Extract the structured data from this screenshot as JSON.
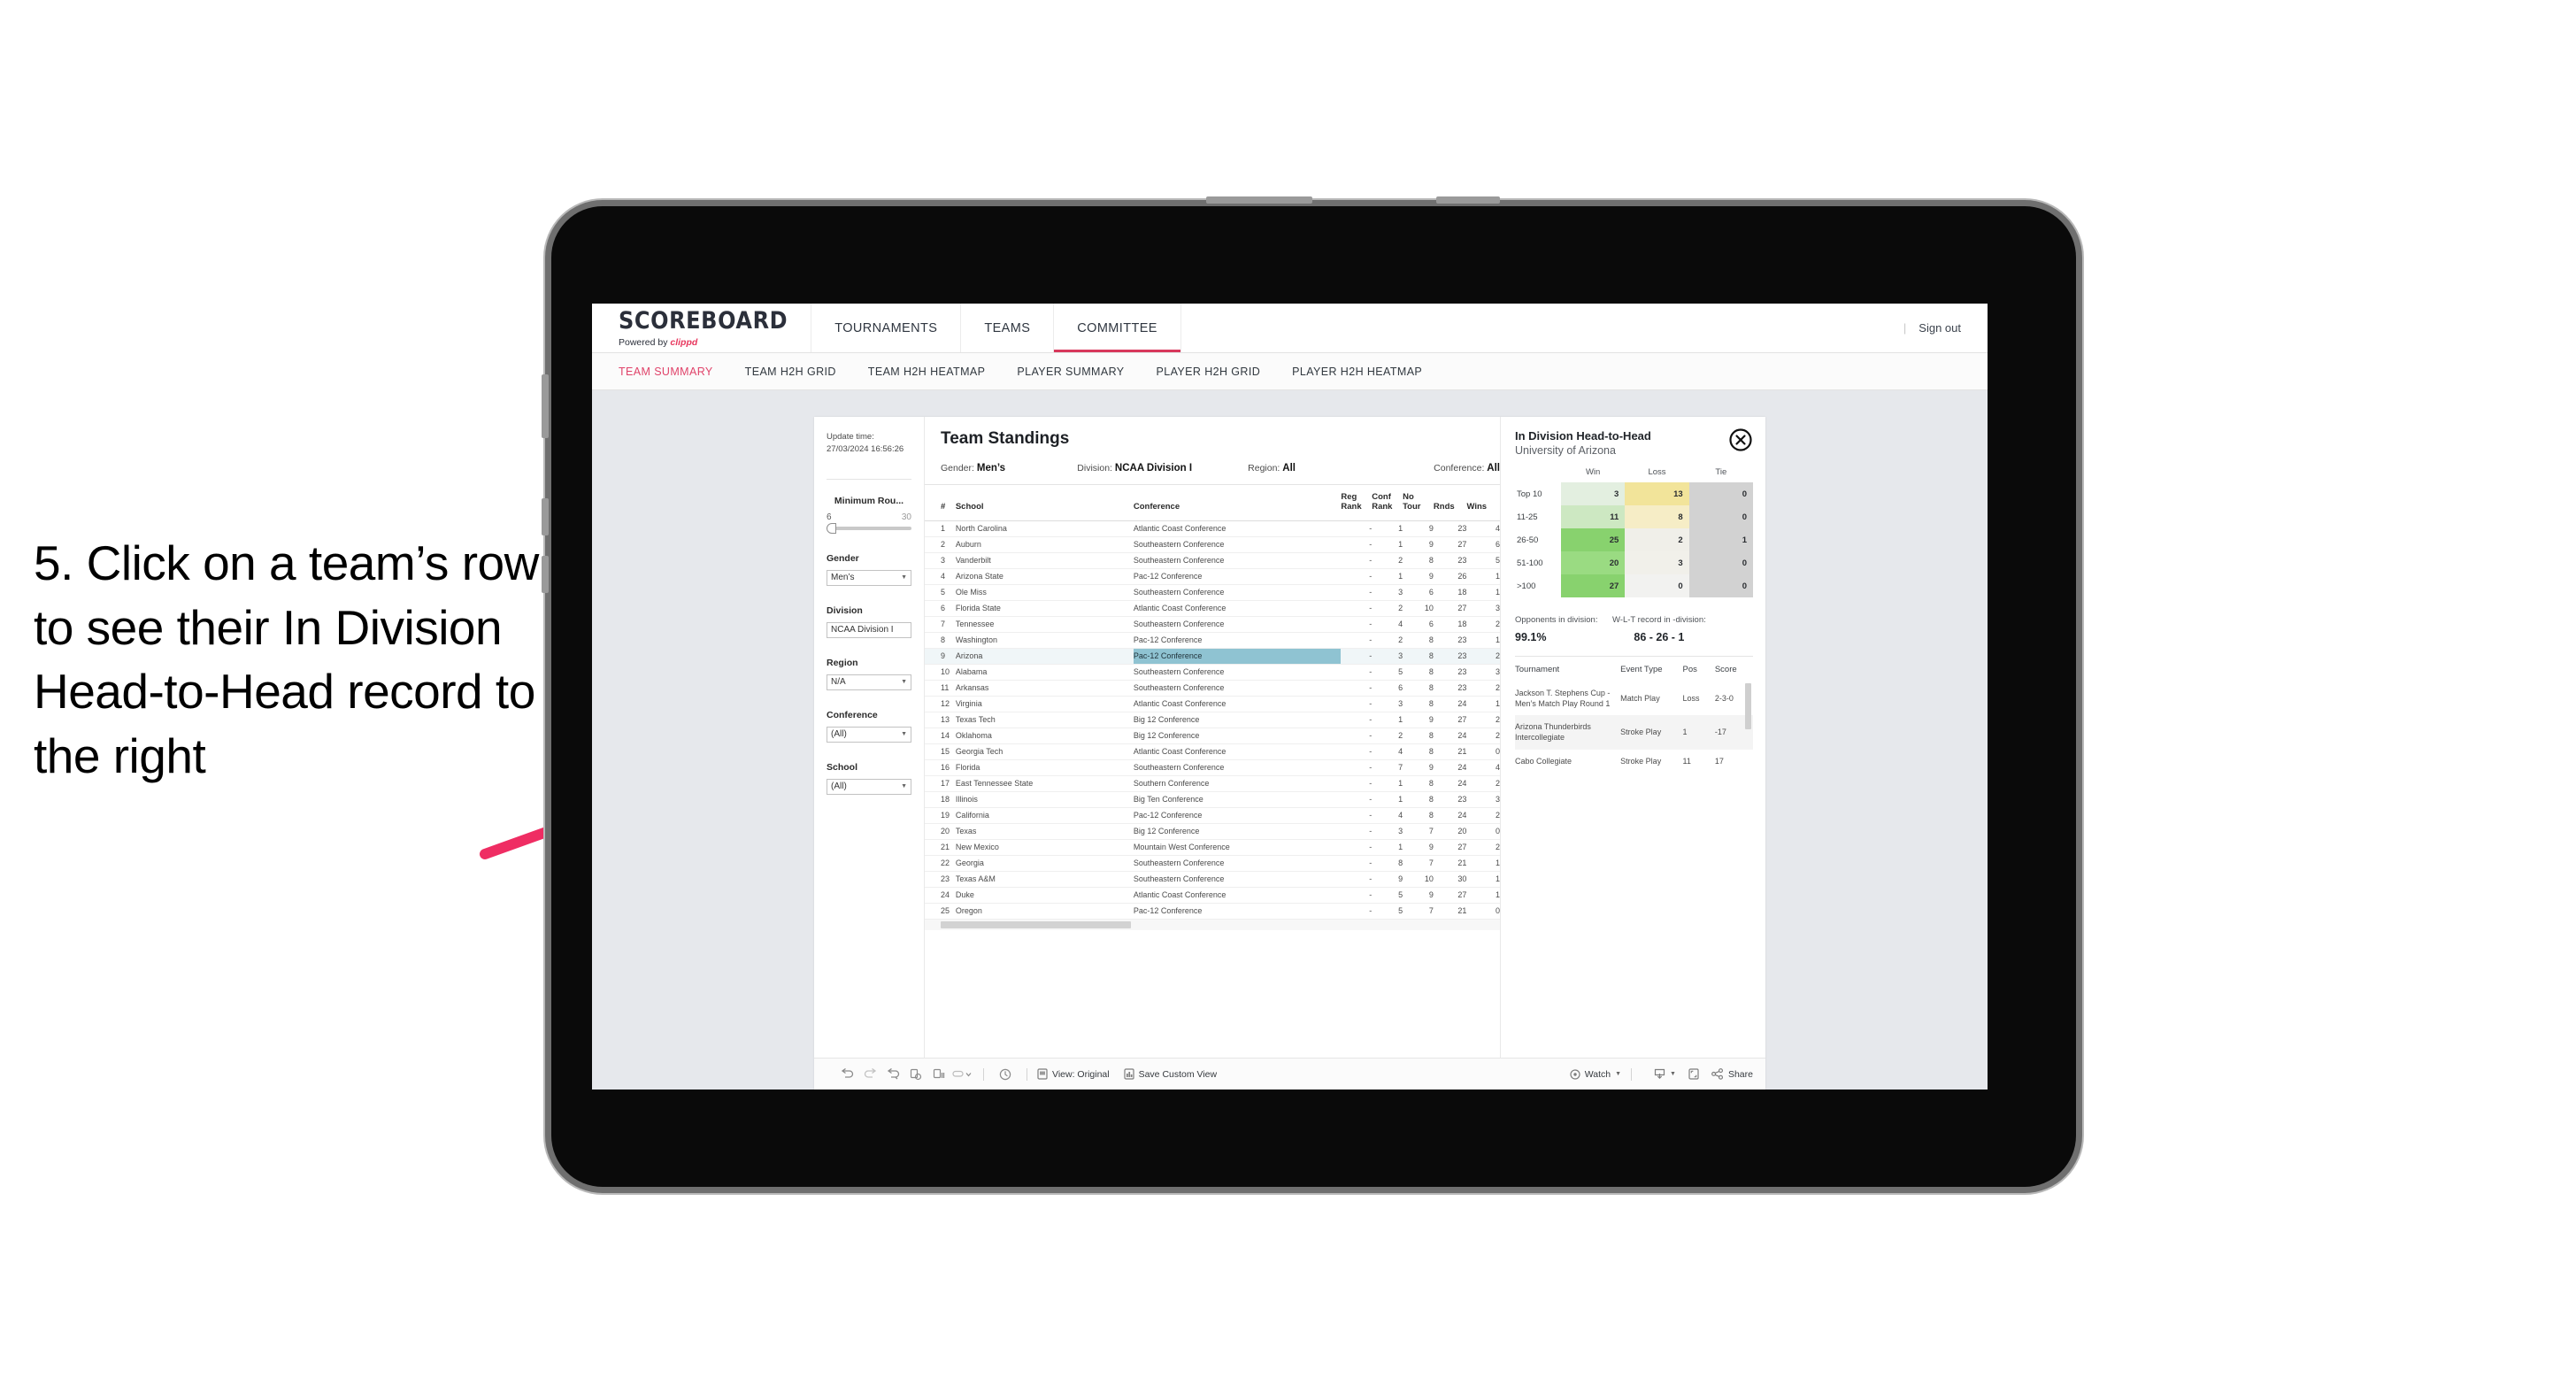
{
  "instruction": {
    "text": "5. Click on a team’s row to see their In Division Head-to-Head record to the right"
  },
  "colors": {
    "accent_pink": "#d8385c",
    "brand_pink": "#e8395f",
    "selected_cell": "#8fc3d2",
    "screen_bg": "#e6e8ec"
  },
  "topnav": {
    "brand_title": "SCOREBOARD",
    "brand_powered": "Powered by ",
    "brand_name": "clippd",
    "items": [
      {
        "label": "TOURNAMENTS",
        "active": false
      },
      {
        "label": "TEAMS",
        "active": false
      },
      {
        "label": "COMMITTEE",
        "active": true
      }
    ],
    "divider": "|",
    "signout": "Sign out"
  },
  "subnav": {
    "items": [
      {
        "label": "TEAM SUMMARY",
        "active": true
      },
      {
        "label": "TEAM H2H GRID",
        "active": false
      },
      {
        "label": "TEAM H2H HEATMAP",
        "active": false
      },
      {
        "label": "PLAYER SUMMARY",
        "active": false
      },
      {
        "label": "PLAYER H2H GRID",
        "active": false
      },
      {
        "label": "PLAYER H2H HEATMAP",
        "active": false
      }
    ]
  },
  "filters": {
    "update_time_label": "Update time:",
    "update_time_value": "27/03/2024 16:56:26",
    "min_rounds": {
      "label": "Minimum Rou...",
      "low": "6",
      "high": "30"
    },
    "gender": {
      "label": "Gender",
      "value": "Men’s"
    },
    "division": {
      "label": "Division",
      "value": "NCAA Division I"
    },
    "region": {
      "label": "Region",
      "value": "N/A"
    },
    "conference": {
      "label": "Conference",
      "value": "(All)"
    },
    "school": {
      "label": "School",
      "value": "(All)"
    }
  },
  "standings": {
    "title": "Team Standings",
    "applied": {
      "gender_label": "Gender:",
      "gender_value": "Men’s",
      "division_label": "Division:",
      "division_value": "NCAA Division I",
      "region_label": "Region:",
      "region_value": "All",
      "conference_label": "Conference:",
      "conference_value": "All"
    },
    "columns": [
      "#",
      "School",
      "Conference",
      "Reg Rank",
      "Conf Rank",
      "No Tour",
      "Rnds",
      "Wins"
    ],
    "rows": [
      {
        "rank": "1",
        "school": "North Carolina",
        "conference": "Atlantic Coast Conference",
        "reg_rank": "-",
        "conf_rank": "1",
        "no_tour": "9",
        "rnds": "23",
        "wins": "4",
        "selected": false
      },
      {
        "rank": "2",
        "school": "Auburn",
        "conference": "Southeastern Conference",
        "reg_rank": "-",
        "conf_rank": "1",
        "no_tour": "9",
        "rnds": "27",
        "wins": "6",
        "selected": false
      },
      {
        "rank": "3",
        "school": "Vanderbilt",
        "conference": "Southeastern Conference",
        "reg_rank": "-",
        "conf_rank": "2",
        "no_tour": "8",
        "rnds": "23",
        "wins": "5",
        "selected": false
      },
      {
        "rank": "4",
        "school": "Arizona State",
        "conference": "Pac-12 Conference",
        "reg_rank": "-",
        "conf_rank": "1",
        "no_tour": "9",
        "rnds": "26",
        "wins": "1",
        "selected": false
      },
      {
        "rank": "5",
        "school": "Ole Miss",
        "conference": "Southeastern Conference",
        "reg_rank": "-",
        "conf_rank": "3",
        "no_tour": "6",
        "rnds": "18",
        "wins": "1",
        "selected": false
      },
      {
        "rank": "6",
        "school": "Florida State",
        "conference": "Atlantic Coast Conference",
        "reg_rank": "-",
        "conf_rank": "2",
        "no_tour": "10",
        "rnds": "27",
        "wins": "3",
        "selected": false
      },
      {
        "rank": "7",
        "school": "Tennessee",
        "conference": "Southeastern Conference",
        "reg_rank": "-",
        "conf_rank": "4",
        "no_tour": "6",
        "rnds": "18",
        "wins": "2",
        "selected": false
      },
      {
        "rank": "8",
        "school": "Washington",
        "conference": "Pac-12 Conference",
        "reg_rank": "-",
        "conf_rank": "2",
        "no_tour": "8",
        "rnds": "23",
        "wins": "1",
        "selected": false
      },
      {
        "rank": "9",
        "school": "Arizona",
        "conference": "Pac-12 Conference",
        "reg_rank": "-",
        "conf_rank": "3",
        "no_tour": "8",
        "rnds": "23",
        "wins": "2",
        "selected": true
      },
      {
        "rank": "10",
        "school": "Alabama",
        "conference": "Southeastern Conference",
        "reg_rank": "-",
        "conf_rank": "5",
        "no_tour": "8",
        "rnds": "23",
        "wins": "3",
        "selected": false
      },
      {
        "rank": "11",
        "school": "Arkansas",
        "conference": "Southeastern Conference",
        "reg_rank": "-",
        "conf_rank": "6",
        "no_tour": "8",
        "rnds": "23",
        "wins": "2",
        "selected": false
      },
      {
        "rank": "12",
        "school": "Virginia",
        "conference": "Atlantic Coast Conference",
        "reg_rank": "-",
        "conf_rank": "3",
        "no_tour": "8",
        "rnds": "24",
        "wins": "1",
        "selected": false
      },
      {
        "rank": "13",
        "school": "Texas Tech",
        "conference": "Big 12 Conference",
        "reg_rank": "-",
        "conf_rank": "1",
        "no_tour": "9",
        "rnds": "27",
        "wins": "2",
        "selected": false
      },
      {
        "rank": "14",
        "school": "Oklahoma",
        "conference": "Big 12 Conference",
        "reg_rank": "-",
        "conf_rank": "2",
        "no_tour": "8",
        "rnds": "24",
        "wins": "2",
        "selected": false
      },
      {
        "rank": "15",
        "school": "Georgia Tech",
        "conference": "Atlantic Coast Conference",
        "reg_rank": "-",
        "conf_rank": "4",
        "no_tour": "8",
        "rnds": "21",
        "wins": "0",
        "selected": false
      },
      {
        "rank": "16",
        "school": "Florida",
        "conference": "Southeastern Conference",
        "reg_rank": "-",
        "conf_rank": "7",
        "no_tour": "9",
        "rnds": "24",
        "wins": "4",
        "selected": false
      },
      {
        "rank": "17",
        "school": "East Tennessee State",
        "conference": "Southern Conference",
        "reg_rank": "-",
        "conf_rank": "1",
        "no_tour": "8",
        "rnds": "24",
        "wins": "2",
        "selected": false
      },
      {
        "rank": "18",
        "school": "Illinois",
        "conference": "Big Ten Conference",
        "reg_rank": "-",
        "conf_rank": "1",
        "no_tour": "8",
        "rnds": "23",
        "wins": "3",
        "selected": false
      },
      {
        "rank": "19",
        "school": "California",
        "conference": "Pac-12 Conference",
        "reg_rank": "-",
        "conf_rank": "4",
        "no_tour": "8",
        "rnds": "24",
        "wins": "2",
        "selected": false
      },
      {
        "rank": "20",
        "school": "Texas",
        "conference": "Big 12 Conference",
        "reg_rank": "-",
        "conf_rank": "3",
        "no_tour": "7",
        "rnds": "20",
        "wins": "0",
        "selected": false
      },
      {
        "rank": "21",
        "school": "New Mexico",
        "conference": "Mountain West Conference",
        "reg_rank": "-",
        "conf_rank": "1",
        "no_tour": "9",
        "rnds": "27",
        "wins": "2",
        "selected": false
      },
      {
        "rank": "22",
        "school": "Georgia",
        "conference": "Southeastern Conference",
        "reg_rank": "-",
        "conf_rank": "8",
        "no_tour": "7",
        "rnds": "21",
        "wins": "1",
        "selected": false
      },
      {
        "rank": "23",
        "school": "Texas A&M",
        "conference": "Southeastern Conference",
        "reg_rank": "-",
        "conf_rank": "9",
        "no_tour": "10",
        "rnds": "30",
        "wins": "1",
        "selected": false
      },
      {
        "rank": "24",
        "school": "Duke",
        "conference": "Atlantic Coast Conference",
        "reg_rank": "-",
        "conf_rank": "5",
        "no_tour": "9",
        "rnds": "27",
        "wins": "1",
        "selected": false
      },
      {
        "rank": "25",
        "school": "Oregon",
        "conference": "Pac-12 Conference",
        "reg_rank": "-",
        "conf_rank": "5",
        "no_tour": "7",
        "rnds": "21",
        "wins": "0",
        "selected": false
      }
    ]
  },
  "h2h": {
    "title": "In Division Head-to-Head",
    "subtitle": "University of Arizona",
    "close_icon": "close-circle-icon",
    "columns": [
      "",
      "Win",
      "Loss",
      "Tie"
    ],
    "rows": [
      {
        "bucket": "Top 10",
        "win": "3",
        "loss": "13",
        "tie": "0",
        "win_color": "#e3efe0",
        "loss_color": "#f2e49a",
        "tie_color": "#d2d2d2"
      },
      {
        "bucket": "11-25",
        "win": "11",
        "loss": "8",
        "tie": "0",
        "win_color": "#cde8c2",
        "loss_color": "#f6edc6",
        "tie_color": "#d2d2d2"
      },
      {
        "bucket": "26-50",
        "win": "25",
        "loss": "2",
        "tie": "1",
        "win_color": "#88d26e",
        "loss_color": "#f0efe9",
        "tie_color": "#d2d2d2"
      },
      {
        "bucket": "51-100",
        "win": "20",
        "loss": "3",
        "tie": "0",
        "win_color": "#9adb82",
        "loss_color": "#f1f0ea",
        "tie_color": "#d2d2d2"
      },
      {
        "bucket": ">100",
        "win": "27",
        "loss": "0",
        "tie": "0",
        "win_color": "#88d26e",
        "loss_color": "#f2f2f0",
        "tie_color": "#d2d2d2"
      }
    ],
    "summary": {
      "opponents_label": "Opponents in division:",
      "opponents_value": "99.1%",
      "record_label": "W-L-T record in -division:",
      "record_value": "86 - 26 - 1"
    },
    "tournaments": {
      "columns": [
        "Tournament",
        "Event Type",
        "Pos",
        "Score"
      ],
      "rows": [
        {
          "name": "Jackson T. Stephens Cup - Men’s Match Play Round 1",
          "event_type": "Match Play",
          "pos": "Loss",
          "score": "2-3-0"
        },
        {
          "name": "Arizona Thunderbirds Intercollegiate",
          "event_type": "Stroke Play",
          "pos": "1",
          "score": "-17"
        },
        {
          "name": "Cabo Collegiate",
          "event_type": "Stroke Play",
          "pos": "11",
          "score": "17"
        }
      ]
    }
  },
  "toolbar": {
    "icons": [
      "undo-icon",
      "redo-icon",
      "revert-icon",
      "refresh-data-icon",
      "pause-updates-icon",
      "alerts-dropdown-icon"
    ],
    "clock_icon": "device-rotate-icon",
    "view_icon": "view-icon",
    "view_label": "View: Original",
    "save_icon": "save-icon",
    "save_label": "Save Custom View",
    "watch_icon": "watch-icon",
    "watch_label": "Watch",
    "download_icon": "download-icon",
    "fullscreen_icon": "fullscreen-icon",
    "share_icon": "share-icon",
    "share_label": "Share"
  }
}
